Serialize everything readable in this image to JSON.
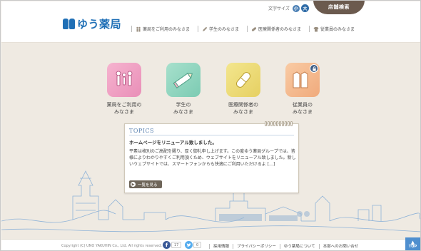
{
  "header": {
    "logo_text": "ゆう薬局",
    "font_size": {
      "label": "文字サイズ",
      "small": "小",
      "large": "大"
    },
    "store_search": "店舗検索",
    "nav": [
      {
        "label": "薬局をご利用のみなさま",
        "icon": "people-icon"
      },
      {
        "label": "学生のみなさま",
        "icon": "pencil-icon"
      },
      {
        "label": "医療関係者のみなさま",
        "icon": "capsule-icon"
      },
      {
        "label": "従業員のみなさま",
        "icon": "uniform-icon"
      }
    ]
  },
  "tiles": [
    {
      "label_line1": "薬局をご利用の",
      "label_line2": "みなさま",
      "icon": "family-icon",
      "color": "#ef9fc3"
    },
    {
      "label_line1": "学生の",
      "label_line2": "みなさま",
      "icon": "pencil-icon",
      "color": "#8fd4bd"
    },
    {
      "label_line1": "医療関係者の",
      "label_line2": "みなさま",
      "icon": "capsule-icon",
      "color": "#eddb74"
    },
    {
      "label_line1": "従業員の",
      "label_line2": "みなさま",
      "icon": "uniform-icon",
      "color": "#f5b88d",
      "locked": true
    }
  ],
  "topics": {
    "heading": "TOPICS",
    "title": "ホームページをリニューアル致しました。",
    "body": "平素は格別のご高配を賜り、厚く御礼申し上げます。この度ゆう薬局グループでは、皆様によりわかりやすくご利用頂くため、ウェブサイトをリニューアル致しました。新しいウェブサイトでは、スマートフォンからも快適にご利用いただけるよ […]",
    "more_label": "一覧を見る"
  },
  "footer": {
    "copyright": "Copyright (C) UNO YAKUHIN Co., Ltd. All rights reserved.",
    "facebook_count": "17",
    "twitter_count": "0",
    "links": [
      "採用情報",
      "プライバシーポリシー",
      "ゆう薬局について",
      "本部へのお問い合せ"
    ],
    "top_label": "TOP"
  },
  "colors": {
    "brand_blue": "#1f6fb6",
    "store_button": "#6b5a4e",
    "background": "#efeae2"
  }
}
